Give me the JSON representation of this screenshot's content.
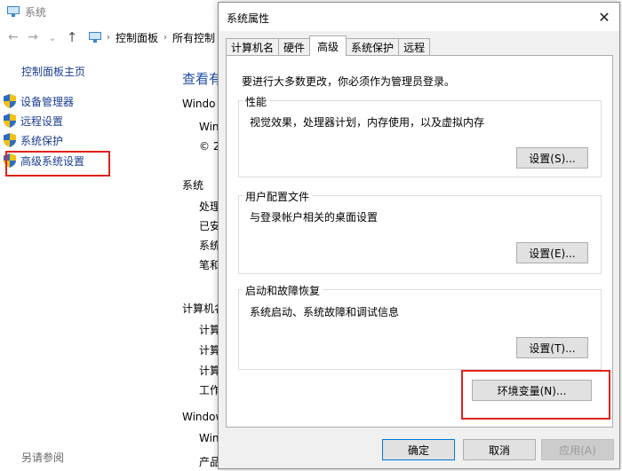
{
  "bg_window": {
    "title": "系统",
    "nav": {
      "back": "←",
      "forward": "→",
      "dropdown": "⌄",
      "up": "↑"
    },
    "breadcrumb": [
      "控制面板",
      "所有控制"
    ],
    "sidebar": {
      "home": "控制面板主页",
      "items": [
        {
          "label": "设备管理器"
        },
        {
          "label": "远程设置"
        },
        {
          "label": "系统保护"
        },
        {
          "label": "高级系统设置"
        }
      ],
      "see_also": "另请参阅"
    },
    "main": {
      "heading": "查看有",
      "windows_edition": "Windo",
      "edition_line1": "Win",
      "edition_line2": "© 2",
      "system_section": "系统",
      "system_rows": [
        "处理",
        "已安",
        "系统",
        "笔和"
      ],
      "computer_section": "计算机名",
      "computer_rows": [
        "计算",
        "计算",
        "计算",
        "工作"
      ],
      "activation_section": "Window",
      "activation_row1": "Win",
      "activation_row2": "产品"
    }
  },
  "dialog": {
    "title": "系统属性",
    "close": "✕",
    "tabs": [
      {
        "label": "计算机名",
        "active": false
      },
      {
        "label": "硬件",
        "active": false
      },
      {
        "label": "高级",
        "active": true
      },
      {
        "label": "系统保护",
        "active": false
      },
      {
        "label": "远程",
        "active": false
      }
    ],
    "admin_note": "要进行大多数更改，你必须作为管理员登录。",
    "groups": {
      "performance": {
        "label": "性能",
        "desc": "视觉效果，处理器计划，内存使用，以及虚拟内存",
        "button": "设置(S)..."
      },
      "user_profiles": {
        "label": "用户配置文件",
        "desc": "与登录帐户相关的桌面设置",
        "button": "设置(E)..."
      },
      "startup": {
        "label": "启动和故障恢复",
        "desc": "系统启动、系统故障和调试信息",
        "button": "设置(T)..."
      }
    },
    "env_button": "环境变量(N)...",
    "ok": "确定",
    "cancel": "取消",
    "apply": "应用(A)"
  }
}
